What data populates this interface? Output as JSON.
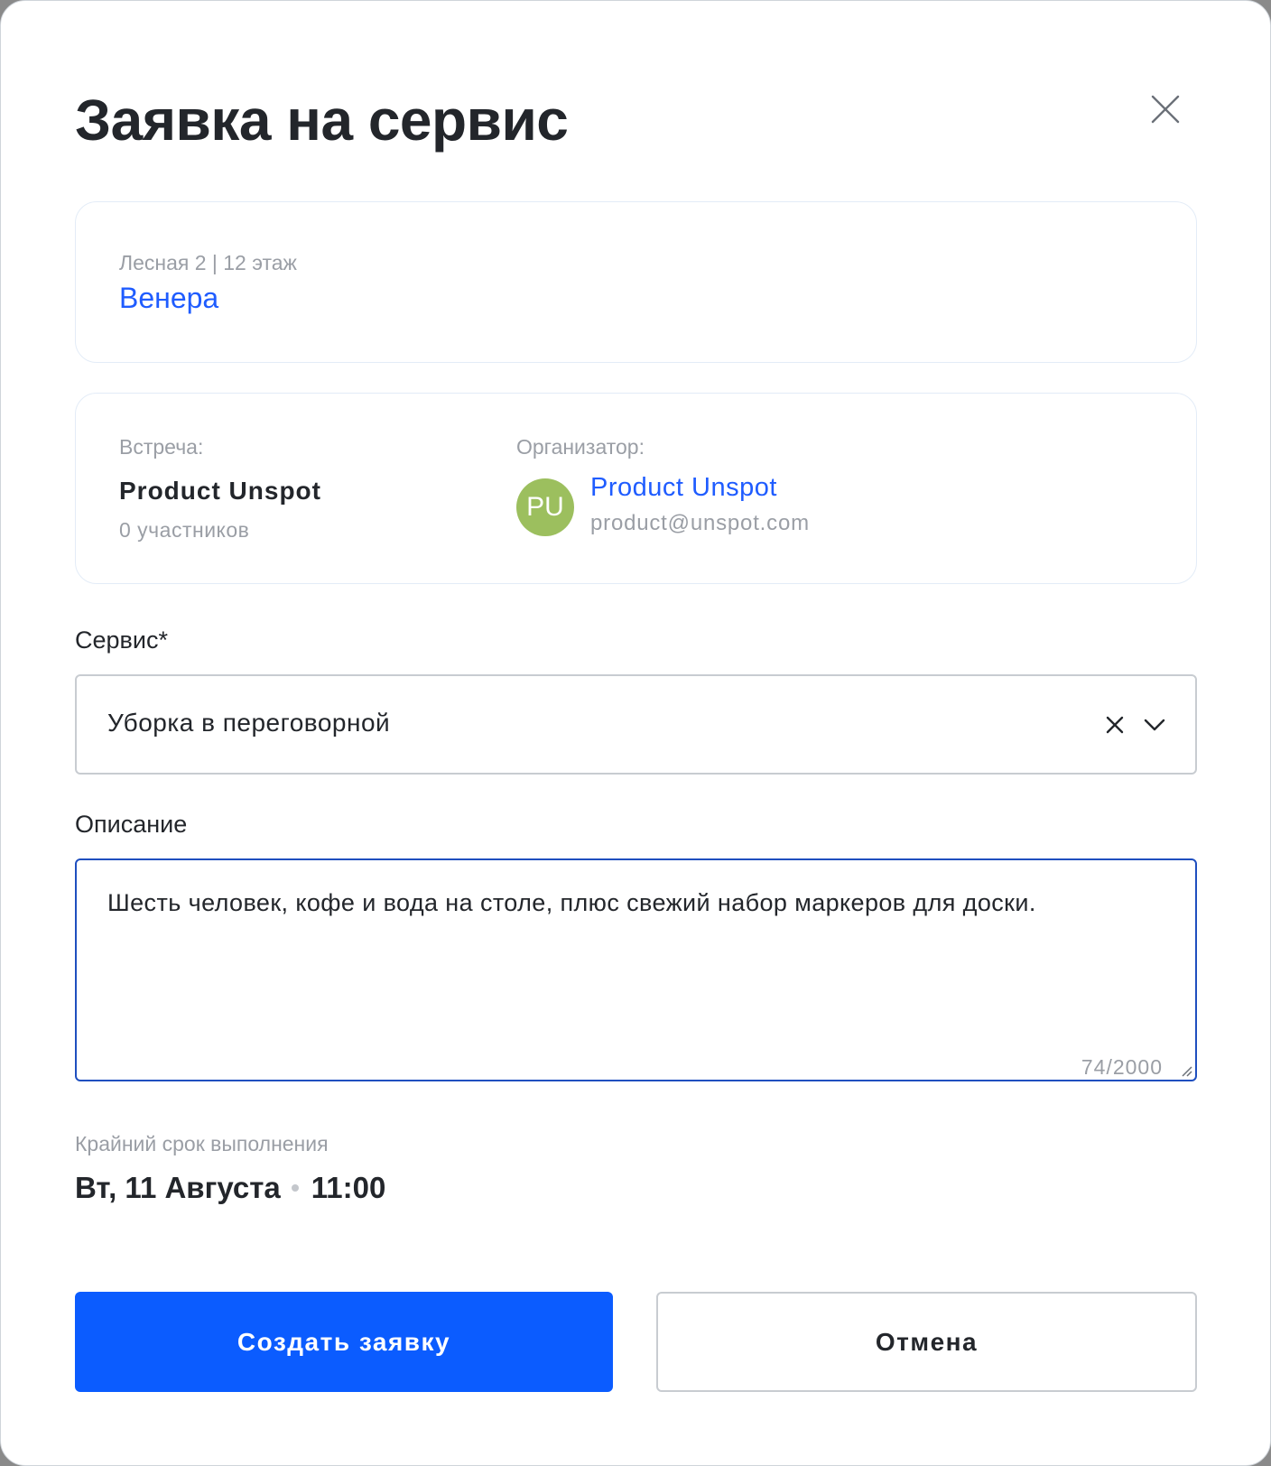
{
  "dialog": {
    "title": "Заявка на сервис"
  },
  "location": {
    "address": "Лесная 2 | 12 этаж",
    "room": "Венера"
  },
  "meeting": {
    "label": "Встреча:",
    "title": "Product Unspot",
    "participants": "0 участников"
  },
  "organizer": {
    "label": "Организатор:",
    "initials": "PU",
    "name": "Product Unspot",
    "email": "product@unspot.com"
  },
  "service": {
    "label": "Сервис*",
    "value": "Уборка в переговорной"
  },
  "description": {
    "label": "Описание",
    "value": "Шесть человек, кофе и вода на столе, плюс свежий набор маркеров для доски.",
    "counter": "74/2000"
  },
  "deadline": {
    "label": "Крайний срок выполнения",
    "date": "Вт, 11 Августа",
    "time": "11:00"
  },
  "actions": {
    "submit_label": "Создать заявку",
    "cancel_label": "Отмена"
  },
  "icons": {
    "close": "close-icon",
    "clear": "clear-icon",
    "dropdown": "chevron-down-icon"
  },
  "colors": {
    "accent": "#0b5cff",
    "link": "#1f5cff",
    "avatar": "#9cbf5e",
    "focus_border": "#1f4fbf"
  }
}
